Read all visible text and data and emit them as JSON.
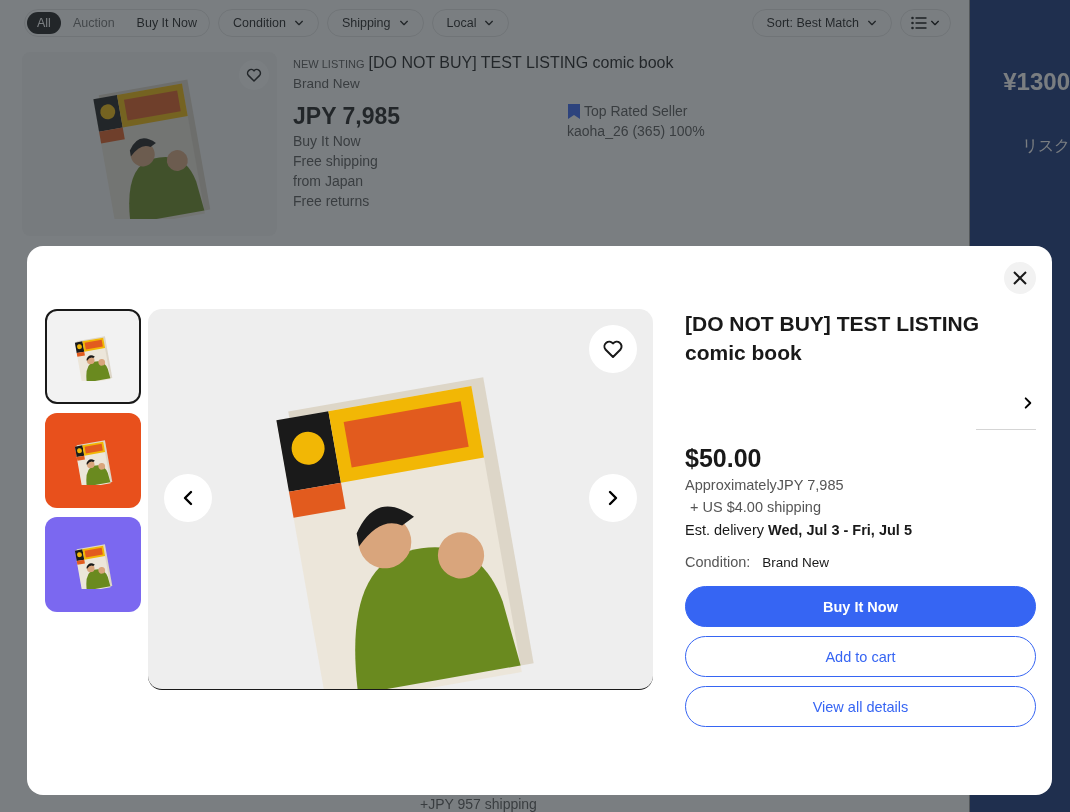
{
  "filters": {
    "formats": [
      {
        "label": "All",
        "selected": true
      },
      {
        "label": "Auction",
        "selected": false
      },
      {
        "label": "Buy It Now",
        "selected": false
      }
    ],
    "dropdowns": [
      "Condition",
      "Shipping",
      "Local"
    ],
    "sort": "Sort: Best Match"
  },
  "background_listing": {
    "badge": "NEW LISTING",
    "title": "[DO NOT BUY] TEST LISTING comic book",
    "condition": "Brand New",
    "price": "JPY 7,985",
    "format": "Buy It Now",
    "shipping": "Free shipping",
    "origin": "from Japan",
    "returns": "Free returns",
    "seller_badge": "Top Rated Seller",
    "seller": "kaoha_26 (365) 100%"
  },
  "ad": {
    "lines": [
      "¥1300",
      "リスク"
    ]
  },
  "next_listing": {
    "shipping": "+JPY 957 shipping"
  },
  "quick_view": {
    "thumbnails": [
      {
        "color": "#f2f2f2",
        "selected": true
      },
      {
        "color": "#e8501c",
        "selected": false
      },
      {
        "color": "#7b68f0",
        "selected": false
      }
    ],
    "title": "[DO NOT BUY] TEST LISTING comic book",
    "price": "$50.00",
    "approx": "ApproximatelyJPY 7,985",
    "shipping": "+ US $4.00 shipping",
    "delivery": "Est. delivery **Wed, Jul 3 - Fri, Jul 5**",
    "condition_label": "Condition:",
    "condition": "Brand New",
    "buttons": [
      {
        "label": "Buy It Now",
        "kind": "primary"
      },
      {
        "label": "Add to cart",
        "kind": "secondary"
      },
      {
        "label": "View all details",
        "kind": "secondary"
      }
    ]
  }
}
